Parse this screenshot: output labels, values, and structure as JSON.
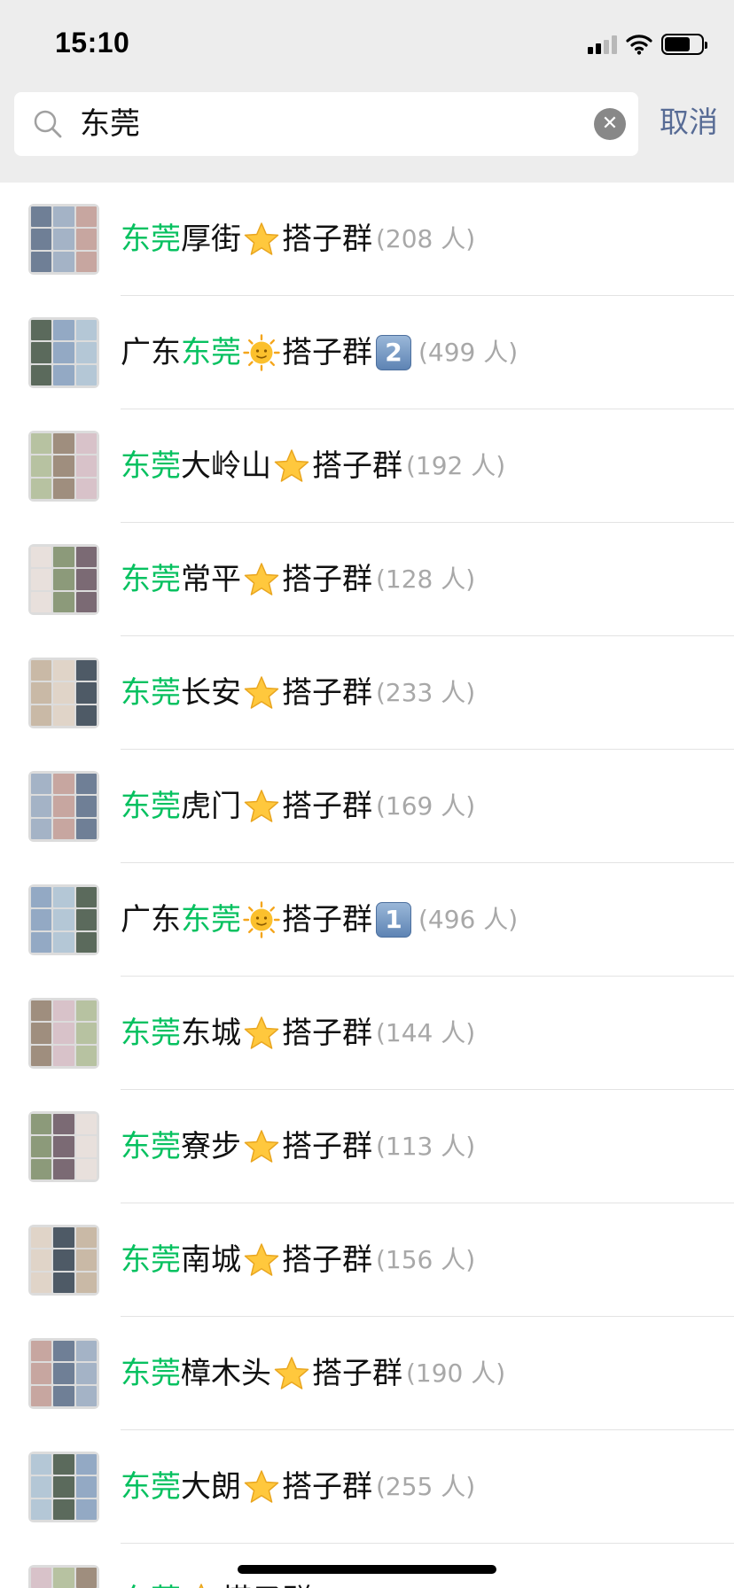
{
  "status_bar": {
    "time": "15:10"
  },
  "search": {
    "query": "东莞",
    "cancel_label": "取消"
  },
  "colors": {
    "highlight": "#07c160",
    "link": "#576b95",
    "count": "#a8a8a8"
  },
  "results": [
    {
      "prefix": "",
      "highlight": "东莞",
      "mid": "厚街",
      "emoji": "star",
      "suffix": "搭子群",
      "number": "",
      "count": "(208 人)"
    },
    {
      "prefix": "广东",
      "highlight": "东莞",
      "mid": "",
      "emoji": "sun-face",
      "suffix": "搭子群",
      "number": "2",
      "count": "(499 人)"
    },
    {
      "prefix": "",
      "highlight": "东莞",
      "mid": "大岭山",
      "emoji": "star",
      "suffix": "搭子群",
      "number": "",
      "count": "(192 人)"
    },
    {
      "prefix": "",
      "highlight": "东莞",
      "mid": "常平",
      "emoji": "star",
      "suffix": "搭子群",
      "number": "",
      "count": "(128 人)"
    },
    {
      "prefix": "",
      "highlight": "东莞",
      "mid": "长安",
      "emoji": "star",
      "suffix": "搭子群",
      "number": "",
      "count": "(233 人)"
    },
    {
      "prefix": "",
      "highlight": "东莞",
      "mid": "虎门",
      "emoji": "star",
      "suffix": "搭子群",
      "number": "",
      "count": "(169 人)"
    },
    {
      "prefix": "广东",
      "highlight": "东莞",
      "mid": "",
      "emoji": "sun-face",
      "suffix": "搭子群",
      "number": "1",
      "count": "(496 人)"
    },
    {
      "prefix": "",
      "highlight": "东莞",
      "mid": "东城",
      "emoji": "star",
      "suffix": "搭子群",
      "number": "",
      "count": "(144 人)"
    },
    {
      "prefix": "",
      "highlight": "东莞",
      "mid": "寮步",
      "emoji": "star",
      "suffix": "搭子群",
      "number": "",
      "count": "(113 人)"
    },
    {
      "prefix": "",
      "highlight": "东莞",
      "mid": "南城",
      "emoji": "star",
      "suffix": "搭子群",
      "number": "",
      "count": "(156 人)"
    },
    {
      "prefix": "",
      "highlight": "东莞",
      "mid": "樟木头",
      "emoji": "star",
      "suffix": "搭子群",
      "number": "",
      "count": "(190 人)"
    },
    {
      "prefix": "",
      "highlight": "东莞",
      "mid": "大朗",
      "emoji": "star",
      "suffix": "搭子群",
      "number": "",
      "count": "(255 人)"
    },
    {
      "prefix": "",
      "highlight": "东莞",
      "mid": "",
      "emoji": "star",
      "suffix": "搭子群",
      "number": "",
      "count": ""
    }
  ]
}
